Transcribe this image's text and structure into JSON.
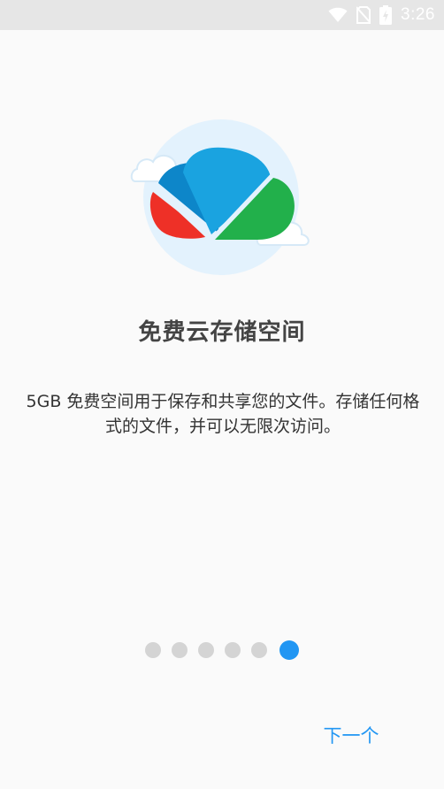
{
  "status_bar": {
    "time": "3:26",
    "icons": [
      "wifi-icon",
      "no-sim-icon",
      "battery-charging-icon"
    ]
  },
  "onboarding": {
    "illustration": "cloud-storage-logo",
    "title": "免费云存储空间",
    "description": "5GB 免费空间用于保存和共享您的文件。存储任何格式的文件，并可以无限次访问。",
    "page_indicator": {
      "total": 6,
      "current": 6
    },
    "next_label": "下一个"
  },
  "colors": {
    "accent": "#2196f3",
    "dot_inactive": "#d4d4d4",
    "cloud_blue": "#1aa3e0",
    "cloud_dark_blue": "#0d86c9",
    "cloud_red": "#ee3027",
    "cloud_green": "#22b04b",
    "halo": "#e3f2fd"
  }
}
